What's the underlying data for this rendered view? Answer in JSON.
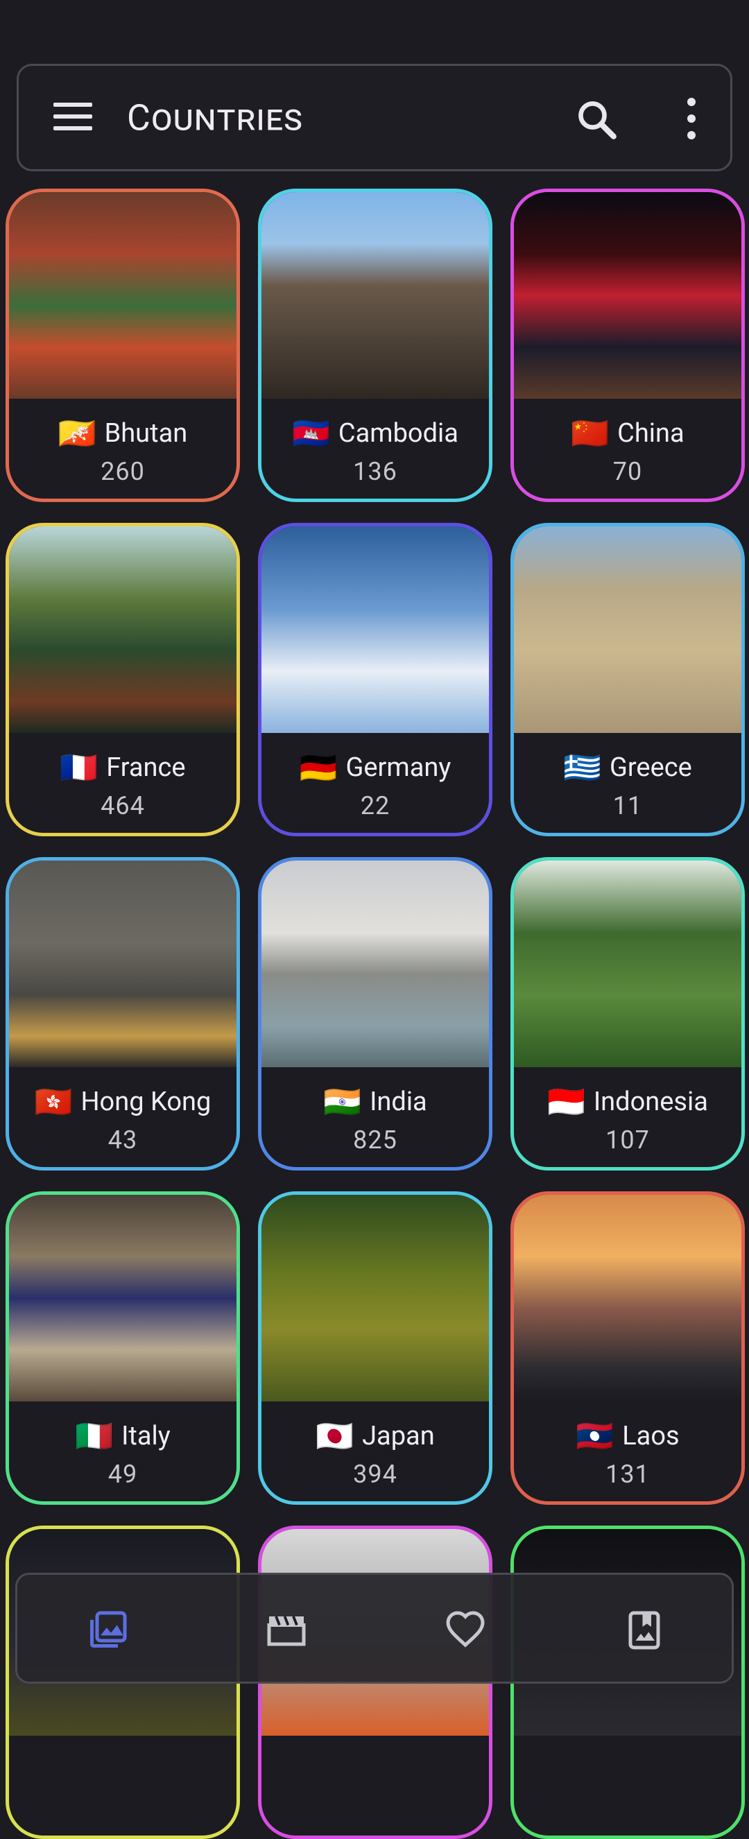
{
  "header": {
    "title": "Countries"
  },
  "icons": {
    "menu": "menu-icon",
    "search": "search-icon",
    "more": "more-vert-icon"
  },
  "colors": {
    "accent": "#5c6ee0",
    "background": "#1c1b21"
  },
  "countries": [
    {
      "flag": "🇧🇹",
      "name": "Bhutan",
      "count": "260",
      "border": "#e06a4f"
    },
    {
      "flag": "🇰🇭",
      "name": "Cambodia",
      "count": "136",
      "border": "#4fd2e6"
    },
    {
      "flag": "🇨🇳",
      "name": "China",
      "count": "70",
      "border": "#d94ee3"
    },
    {
      "flag": "🇫🇷",
      "name": "France",
      "count": "464",
      "border": "#e8cf4c"
    },
    {
      "flag": "🇩🇪",
      "name": "Germany",
      "count": "22",
      "border": "#5e4fe0"
    },
    {
      "flag": "🇬🇷",
      "name": "Greece",
      "count": "11",
      "border": "#4fb3e6"
    },
    {
      "flag": "🇭🇰",
      "name": "Hong Kong",
      "count": "43",
      "border": "#4fb0e6"
    },
    {
      "flag": "🇮🇳",
      "name": "India",
      "count": "825",
      "border": "#4f87e6"
    },
    {
      "flag": "🇮🇩",
      "name": "Indonesia",
      "count": "107",
      "border": "#4fe0c6"
    },
    {
      "flag": "🇮🇹",
      "name": "Italy",
      "count": "49",
      "border": "#4fe08a"
    },
    {
      "flag": "🇯🇵",
      "name": "Japan",
      "count": "394",
      "border": "#4fc8e6"
    },
    {
      "flag": "🇱🇦",
      "name": "Laos",
      "count": "131",
      "border": "#e0604f"
    },
    {
      "flag": "",
      "name": "",
      "count": "",
      "border": "#d8e04f"
    },
    {
      "flag": "",
      "name": "",
      "count": "",
      "border": "#d94ee3"
    },
    {
      "flag": "",
      "name": "",
      "count": "",
      "border": "#4fe06a"
    }
  ],
  "bottom_nav": [
    {
      "icon": "photo-library-icon",
      "active": true
    },
    {
      "icon": "movie-clapper-icon",
      "active": false
    },
    {
      "icon": "favorite-heart-icon",
      "active": false
    },
    {
      "icon": "collections-bookmark-icon",
      "active": false
    }
  ]
}
